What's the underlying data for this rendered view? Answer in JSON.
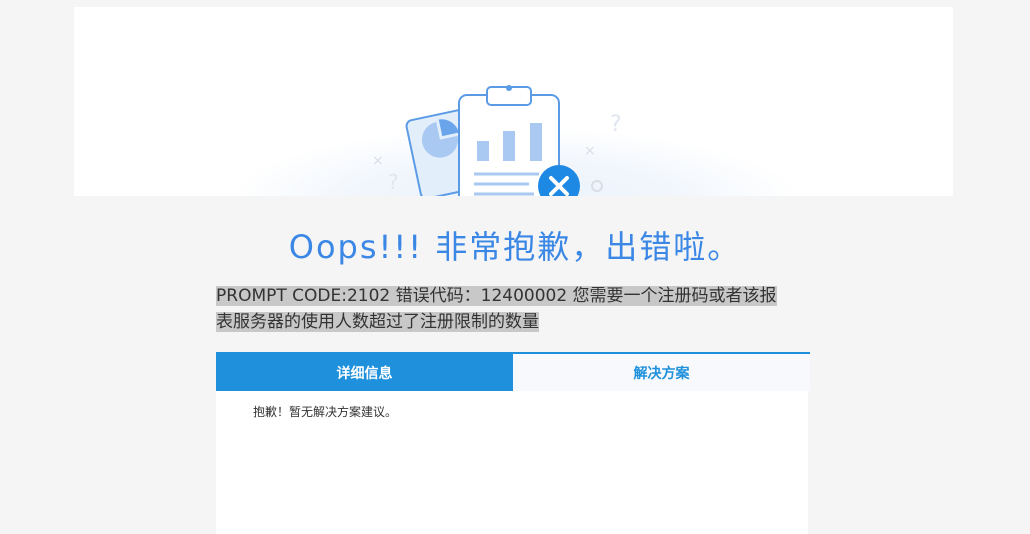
{
  "colors": {
    "accent": "#3a87e6",
    "tab_active": "#1e90dc",
    "background": "#f5f5f5"
  },
  "illustration": {
    "icon": "clipboard-chart-error-illustration",
    "decor_marks": [
      "?",
      "?",
      "×",
      "×"
    ]
  },
  "title": "Oops!!! 非常抱歉，出错啦。",
  "error": {
    "line1": "PROMPT CODE:2102 错误代码：12400002 您需要一个注册码或者该报",
    "line2": "表服务器的使用人数超过了注册限制的数量"
  },
  "tabs": [
    {
      "label": "详细信息",
      "active": true
    },
    {
      "label": "解决方案",
      "active": false
    }
  ],
  "panel": {
    "text": "抱歉！暂无解决方案建议。"
  }
}
